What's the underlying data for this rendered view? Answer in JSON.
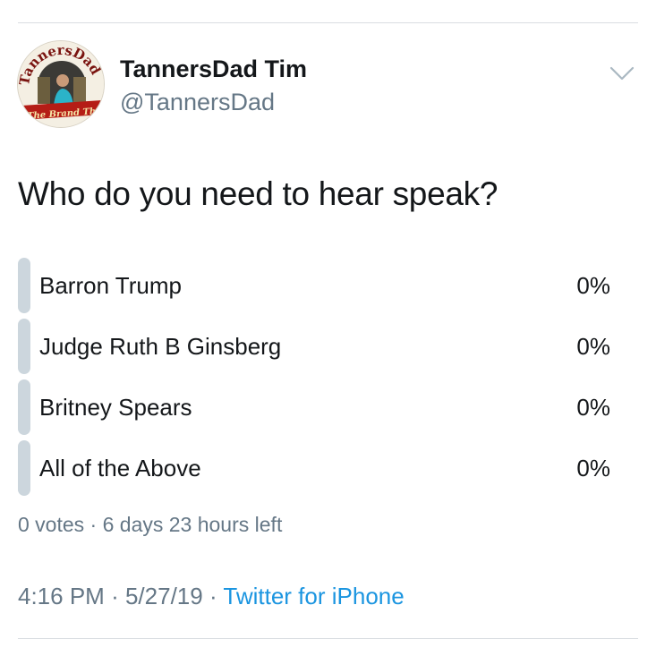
{
  "tweet": {
    "author": {
      "display_name": "TannersDad Tim",
      "handle": "@TannersDad",
      "avatar": {
        "icon": "avatar-logo-icon",
        "arc_text": "TannersDad",
        "banner_text": "The Brand That Ca..."
      }
    },
    "text": "Who do you need to hear speak?",
    "poll": {
      "options": [
        {
          "label": "Barron Trump",
          "percent": "0%"
        },
        {
          "label": "Judge Ruth B Ginsberg",
          "percent": "0%"
        },
        {
          "label": "Britney Spears",
          "percent": "0%"
        },
        {
          "label": "All of the Above",
          "percent": "0%"
        }
      ],
      "meta": "0 votes · 6 days 23 hours left"
    },
    "footer": {
      "time": "4:16 PM",
      "date": "5/27/19",
      "separator": "·",
      "source": "Twitter for iPhone"
    }
  },
  "icons": {
    "menu": "chevron-down-icon"
  },
  "colors": {
    "text_primary": "#14171a",
    "text_secondary": "#657786",
    "link": "#1b95e0",
    "poll_bar": "#ccd6dd",
    "divider": "#d9dde1"
  }
}
